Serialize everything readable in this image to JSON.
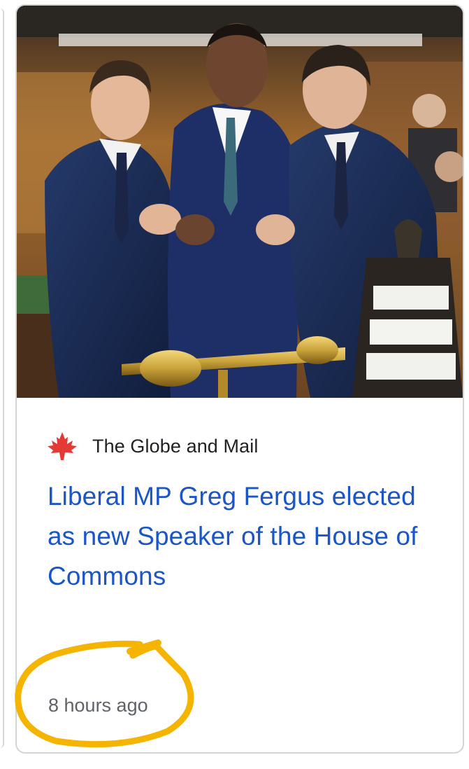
{
  "card": {
    "image_alt": "Three men in suits laughing together in the House of Commons",
    "source": {
      "name": "The Globe and Mail",
      "icon": "maple-leaf-icon",
      "icon_color": "#e53935"
    },
    "headline": "Liberal MP Greg Fergus elected as new Speaker of the House of Commons",
    "timestamp": "8 hours ago"
  },
  "annotation": {
    "type": "hand-drawn-circle",
    "color": "#f5b400",
    "target": "timestamp"
  }
}
